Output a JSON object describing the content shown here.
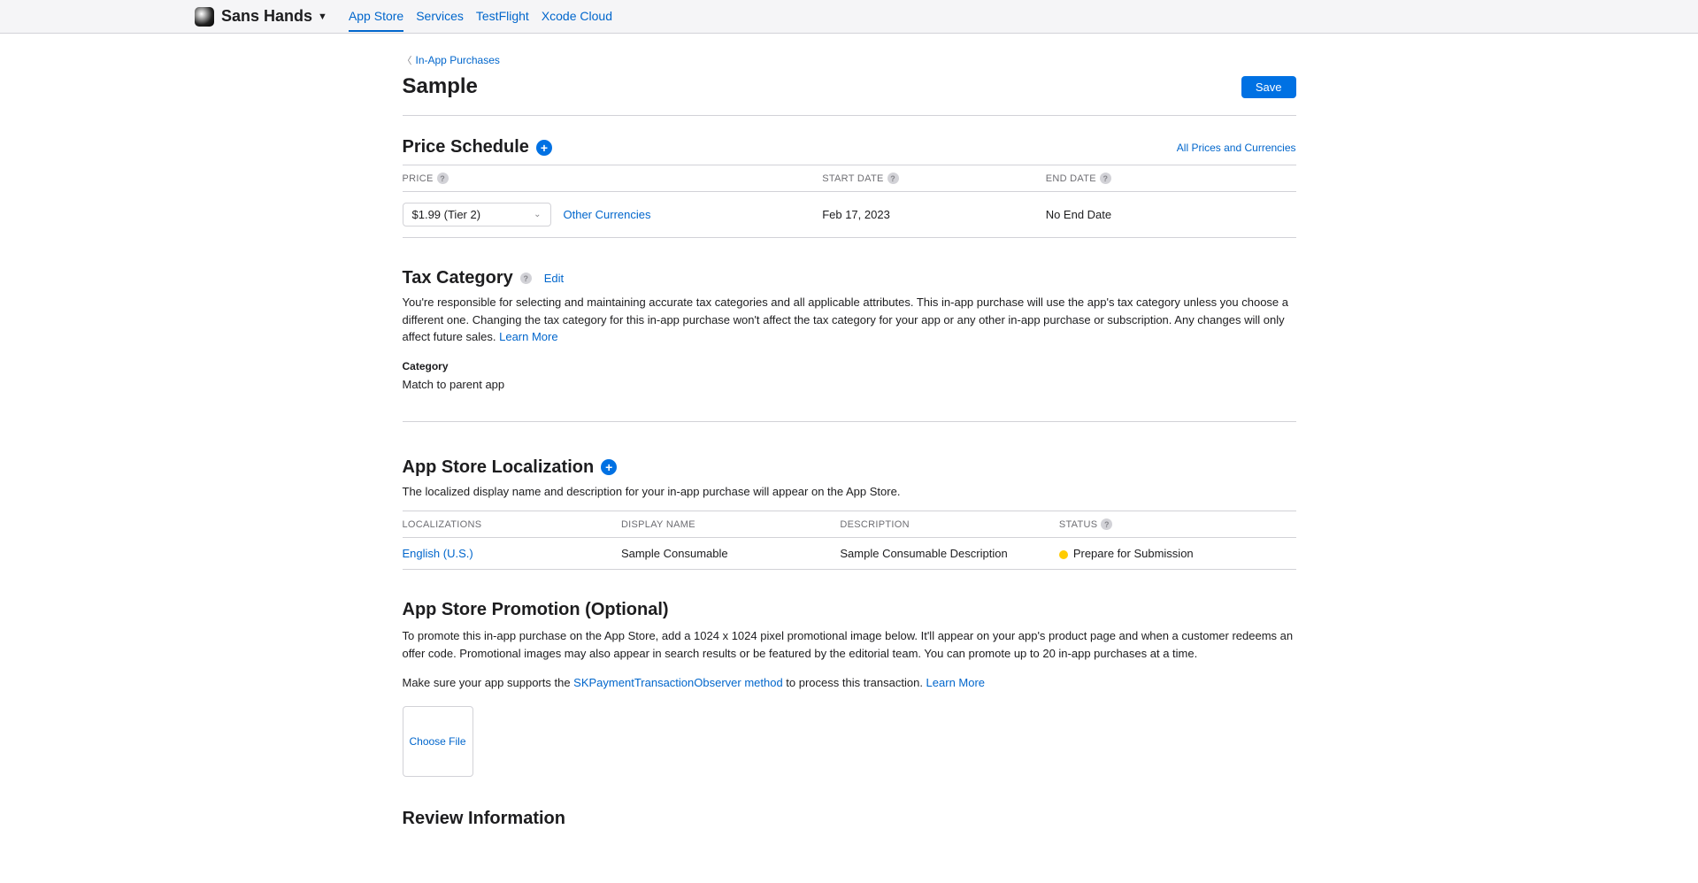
{
  "header": {
    "app_name": "Sans Hands",
    "tabs": [
      "App Store",
      "Services",
      "TestFlight",
      "Xcode Cloud"
    ]
  },
  "breadcrumb": {
    "parent": "In-App Purchases"
  },
  "page": {
    "title": "Sample",
    "save_label": "Save"
  },
  "price_schedule": {
    "title": "Price Schedule",
    "all_prices_link": "All Prices and Currencies",
    "columns": {
      "price": "PRICE",
      "start_date": "START DATE",
      "end_date": "END DATE"
    },
    "row": {
      "price_value": "$1.99 (Tier 2)",
      "other_currencies": "Other Currencies",
      "start_date": "Feb 17, 2023",
      "end_date": "No End Date"
    }
  },
  "tax_category": {
    "title": "Tax Category",
    "edit": "Edit",
    "description": "You're responsible for selecting and maintaining accurate tax categories and all applicable attributes. This in-app purchase will use the app's tax category unless you choose a different one. Changing the tax category for this in-app purchase won't affect the tax category for your app or any other in-app purchase or subscription. Any changes will only affect future sales. ",
    "learn_more": "Learn More",
    "category_label": "Category",
    "category_value": "Match to parent app"
  },
  "localization": {
    "title": "App Store Localization",
    "description": "The localized display name and description for your in-app purchase will appear on the App Store.",
    "columns": {
      "localizations": "LOCALIZATIONS",
      "display_name": "DISPLAY NAME",
      "description": "DESCRIPTION",
      "status": "STATUS"
    },
    "row": {
      "locale": "English (U.S.)",
      "display_name": "Sample Consumable",
      "description": "Sample Consumable Description",
      "status": "Prepare for Submission"
    }
  },
  "promotion": {
    "title": "App Store Promotion (Optional)",
    "description": "To promote this in-app purchase on the App Store, add a 1024 x 1024 pixel promotional image below. It'll appear on your app's product page and when a customer redeems an offer code. Promotional images may also appear in search results or be featured by the editorial team. You can promote up to 20 in-app purchases at a time.",
    "note_prefix": "Make sure your app supports the ",
    "note_link": "SKPaymentTransactionObserver method",
    "note_suffix": " to process this transaction. ",
    "learn_more": "Learn More",
    "choose_file": "Choose File"
  },
  "review": {
    "title": "Review Information"
  }
}
